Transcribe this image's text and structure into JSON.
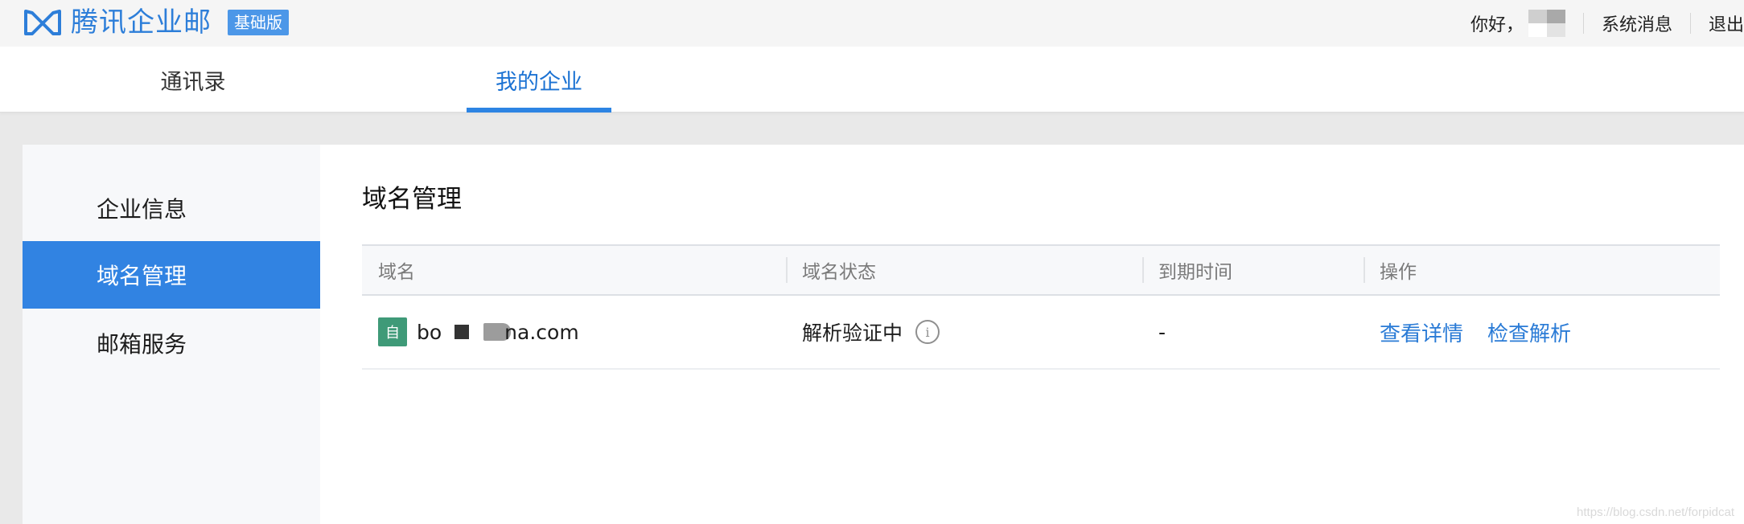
{
  "header": {
    "logo_text": "腾讯企业邮",
    "edition": "基础版",
    "greeting": "你好，",
    "messages": "系统消息",
    "logout": "退出"
  },
  "nav": {
    "tabs": [
      {
        "label": "通讯录"
      },
      {
        "label": "我的企业",
        "active": true
      }
    ]
  },
  "sidebar": {
    "items": [
      {
        "label": "企业信息"
      },
      {
        "label": "域名管理",
        "active": true
      },
      {
        "label": "邮箱服务"
      }
    ]
  },
  "main": {
    "title": "域名管理",
    "table": {
      "headers": [
        "域名",
        "域名状态",
        "到期时间",
        "操作"
      ],
      "rows": [
        {
          "tag": "自",
          "domain_prefix": "bo",
          "domain_suffix": "na.com",
          "status": "解析验证中",
          "expiry": "-",
          "actions": [
            "查看详情",
            "检查解析"
          ]
        }
      ]
    }
  },
  "watermark": "https://blog.csdn.net/forpidcat",
  "colors": {
    "brand": "#2d7ed9",
    "active_tab": "#1b72d3",
    "sidebar_active": "#3183e2",
    "link": "#2a7bd6",
    "tag": "#3f9a78"
  }
}
